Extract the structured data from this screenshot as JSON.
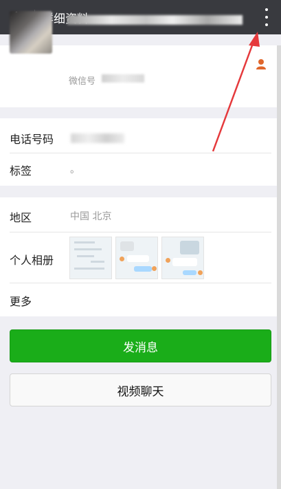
{
  "header": {
    "title": "详细资料"
  },
  "profile": {
    "wechat_id_prefix": "微信号"
  },
  "info": {
    "phone_label": "电话号码",
    "tags_label": "标签",
    "tags_value": "。",
    "region_label": "地区",
    "region_value": "中国  北京",
    "album_label": "个人相册",
    "more_label": "更多"
  },
  "actions": {
    "send_label": "发消息",
    "video_label": "视频聊天"
  },
  "colors": {
    "topbar": "#393a3f",
    "primary": "#1aad19",
    "annotation_arrow": "#e5393c"
  }
}
